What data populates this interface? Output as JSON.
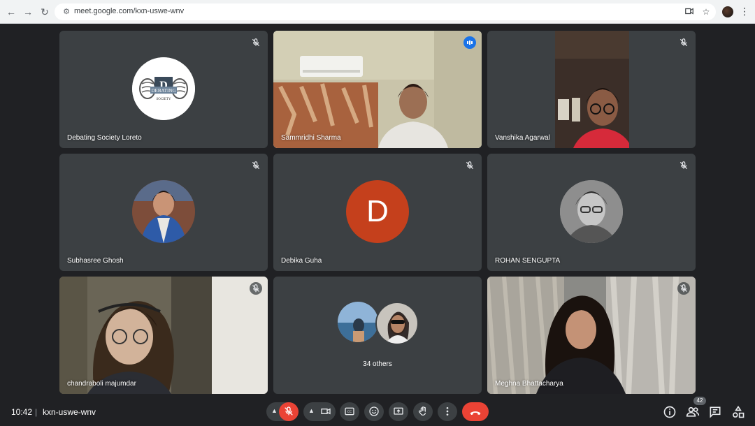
{
  "browser": {
    "url": "meet.google.com/kxn-uswe-wnv"
  },
  "tiles": [
    {
      "name": "Debating Society Loreto",
      "logo_text_top": "DEBATING",
      "logo_text_bottom": "SOCIETY"
    },
    {
      "name": "Sammridhi Sharma"
    },
    {
      "name": "Vanshika Agarwal"
    },
    {
      "name": "Subhasree Ghosh"
    },
    {
      "name": "Debika Guha",
      "avatar_letter": "D"
    },
    {
      "name": "ROHAN SENGUPTA"
    },
    {
      "name": "chandraboli majumdar"
    },
    {
      "name": "34 others"
    },
    {
      "name": "Meghna Bhattacharya"
    }
  ],
  "bottom_bar": {
    "time": "10:42",
    "separator": "|",
    "meeting_code": "kxn-uswe-wnv",
    "people_count": "42"
  },
  "colors": {
    "background": "#202124",
    "tile": "#3c4043",
    "accent_blue": "#8ab4f8",
    "end_call_red": "#ea4335",
    "avatar_d": "#c5401c"
  }
}
